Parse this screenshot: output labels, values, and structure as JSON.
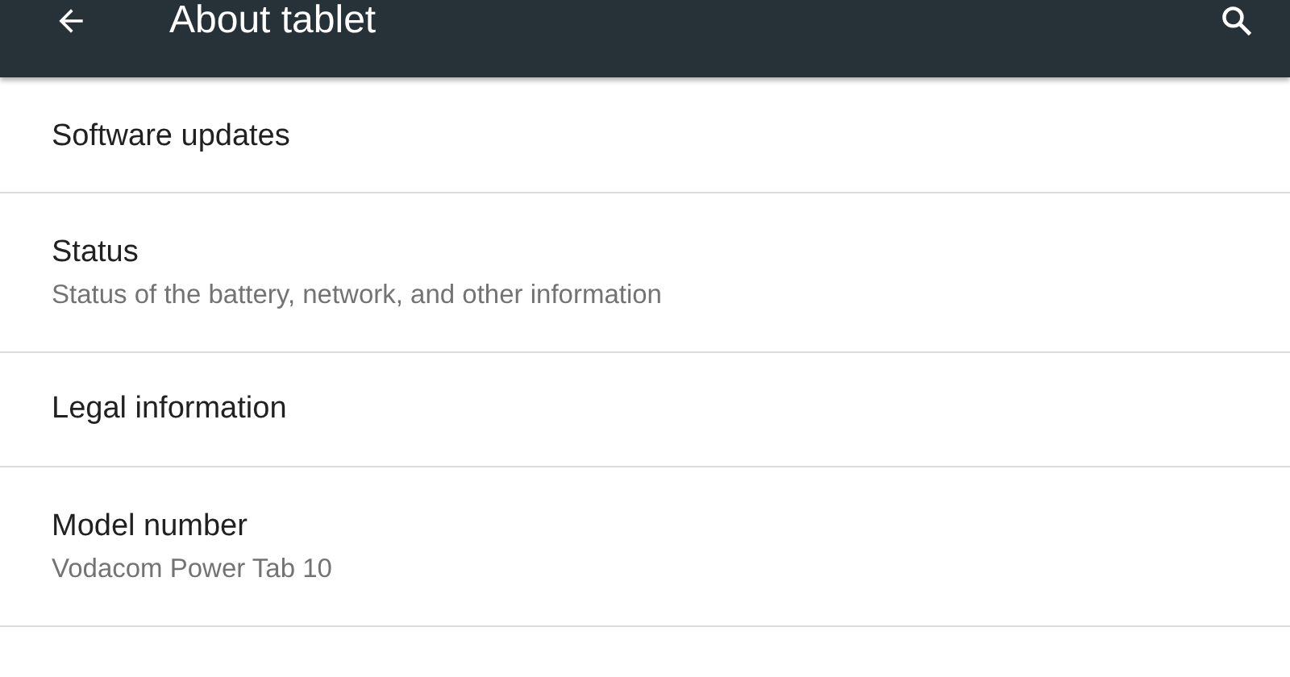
{
  "toolbar": {
    "title": "About tablet"
  },
  "items": [
    {
      "title": "Software updates"
    },
    {
      "title": "Status",
      "summary": "Status of the battery, network, and other information"
    },
    {
      "title": "Legal information"
    },
    {
      "title": "Model number",
      "summary": "Vodacom Power Tab 10"
    }
  ]
}
